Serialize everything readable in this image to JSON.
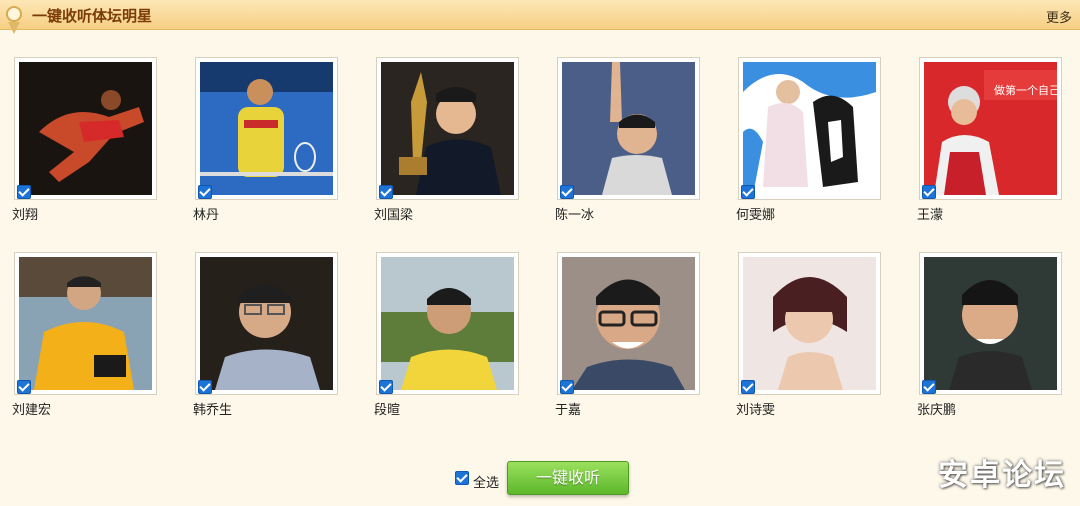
{
  "header": {
    "title": "一键收听体坛明星",
    "more_label": "更多"
  },
  "stars": [
    {
      "name": "刘翔",
      "checked": true,
      "photo": "athlete-hurdling"
    },
    {
      "name": "林丹",
      "checked": true,
      "photo": "badminton-player"
    },
    {
      "name": "刘国梁",
      "checked": true,
      "photo": "man-holding-trophy"
    },
    {
      "name": "陈一冰",
      "checked": true,
      "photo": "gymnast-pointing-up"
    },
    {
      "name": "何雯娜",
      "checked": true,
      "photo": "woman-with-dog"
    },
    {
      "name": "王濛",
      "checked": true,
      "photo": "skater-with-flag"
    },
    {
      "name": "刘建宏",
      "checked": true,
      "photo": "man-with-camera"
    },
    {
      "name": "韩乔生",
      "checked": true,
      "photo": "man-with-glasses"
    },
    {
      "name": "段暄",
      "checked": true,
      "photo": "man-outdoors"
    },
    {
      "name": "于嘉",
      "checked": true,
      "photo": "man-with-glasses-smiling"
    },
    {
      "name": "刘诗雯",
      "checked": true,
      "photo": "woman-short-hair"
    },
    {
      "name": "张庆鹏",
      "checked": true,
      "photo": "man-smiling"
    }
  ],
  "footer": {
    "select_all_label": "全选",
    "select_all_checked": true,
    "listen_all_label": "一键收听"
  },
  "watermark": "安卓论坛",
  "colors": {
    "header_bg": "#f6cf84",
    "title_text": "#7a3b06",
    "checkbox": "#1d74d6",
    "button_green": "#5cb82a",
    "page_bg": "#fdf8ea"
  }
}
